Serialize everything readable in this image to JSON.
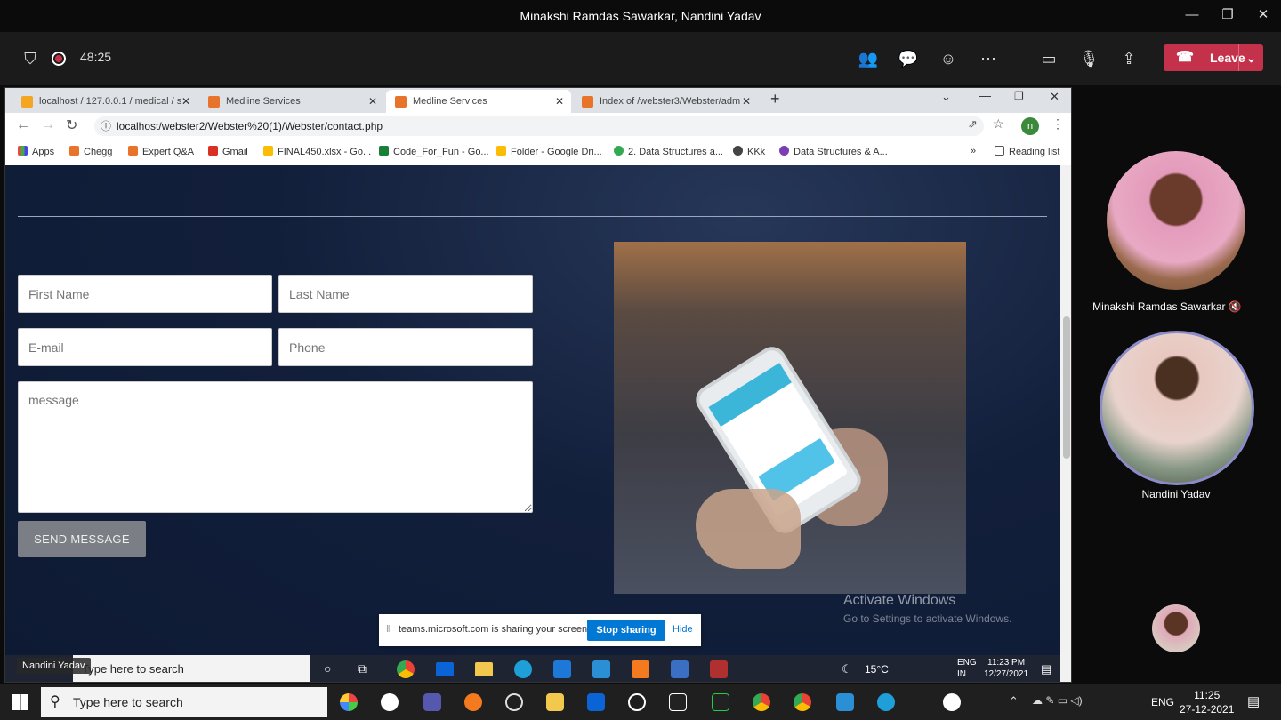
{
  "window": {
    "title": "Minakshi Ramdas Sawarkar, Nandini Yadav"
  },
  "meeting": {
    "timer": "48:25",
    "leave_label": "Leave"
  },
  "browser": {
    "tabs": [
      {
        "label": "localhost / 127.0.0.1 / medical / s"
      },
      {
        "label": "Medline Services"
      },
      {
        "label": "Medline Services"
      },
      {
        "label": "Index of /webster3/Webster/adm"
      }
    ],
    "new_tab": "+",
    "url": "localhost/webster2/Webster%20(1)/Webster/contact.php",
    "profile_initial": "n",
    "bookmarks": [
      "Apps",
      "Chegg",
      "Expert Q&A",
      "Gmail",
      "FINAL450.xlsx - Go...",
      "Code_For_Fun - Go...",
      "Folder - Google Dri...",
      "2. Data Structures a...",
      "KKk",
      "Data Structures & A..."
    ],
    "bookmarks_more": "»",
    "reading_list": "Reading list"
  },
  "form": {
    "first_name_placeholder": "First Name",
    "last_name_placeholder": "Last Name",
    "email_placeholder": "E-mail",
    "phone_placeholder": "Phone",
    "message_placeholder": "message",
    "send_label": "SEND MESSAGE"
  },
  "watermark": {
    "line1": "Activate Windows",
    "line2": "Go to Settings to activate Windows."
  },
  "share_banner": {
    "text": "teams.microsoft.com is sharing your screen.",
    "stop": "Stop sharing",
    "hide": "Hide"
  },
  "inner_taskbar": {
    "search": "Type here to search",
    "weather": "15°C",
    "lang": "ENG",
    "region": "IN",
    "time": "11:23 PM",
    "date": "12/27/2021",
    "presenter_tag": "Nandini Yadav"
  },
  "participants": [
    {
      "name": "Minakshi Ramdas Sawarkar",
      "muted": true
    },
    {
      "name": "Nandini Yadav",
      "muted": false
    }
  ],
  "taskbar": {
    "search": "Type here to search",
    "lang": "ENG",
    "time": "11:25",
    "date": "27-12-2021"
  },
  "colors": {
    "leave": "#c4314b",
    "accent": "#0078d4",
    "page_bg": "#121f3b"
  }
}
